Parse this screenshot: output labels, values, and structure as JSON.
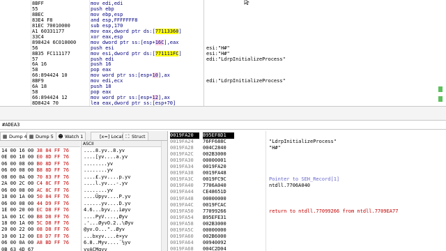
{
  "disasm": {
    "rows": [
      {
        "bytes": "8BFF",
        "instr": "mov edi,edi",
        "comment": ""
      },
      {
        "bytes": "55",
        "instr": "push ebp",
        "comment": ""
      },
      {
        "bytes": "8BEC",
        "instr": "mov ebp,esp",
        "comment": ""
      },
      {
        "bytes": "83E4 F8",
        "instr": "and esp,FFFFFFF8",
        "comment": ""
      },
      {
        "bytes": "81EC 70010000",
        "instr": "sub esp,170",
        "comment": ""
      },
      {
        "bytes": "A1 60331177",
        "instr": "mov eax,dword ptr ds:[77113360]",
        "comment": ""
      },
      {
        "bytes": "33C4",
        "instr": "xor eax,esp",
        "comment": ""
      },
      {
        "bytes": "898424 6C010000",
        "instr": "mov dword ptr ss:[esp+16C],eax",
        "comment": ""
      },
      {
        "bytes": "56",
        "instr": "push esi",
        "comment": "esi:\"H#\""
      },
      {
        "bytes": "8B35 FC111177",
        "instr": "mov esi,dword ptr ds:[771111FC]",
        "comment": "esi:\"H#\""
      },
      {
        "bytes": "57",
        "instr": "push edi",
        "comment": "edi:\"LdrpInitializeProcess\""
      },
      {
        "bytes": "6A 16",
        "instr": "push 16",
        "comment": ""
      },
      {
        "bytes": "58",
        "instr": "pop eax",
        "comment": ""
      },
      {
        "bytes": "66:894424 10",
        "instr": "mov word ptr ss:[esp+10],ax",
        "comment": ""
      },
      {
        "bytes": "8BF9",
        "instr": "mov edi,ecx",
        "comment": "edi:\"LdrpInitializeProcess\""
      },
      {
        "bytes": "6A 18",
        "instr": "push 18",
        "comment": ""
      },
      {
        "bytes": "58",
        "instr": "pop eax",
        "comment": ""
      },
      {
        "bytes": "66:894424 12",
        "instr": "mov word ptr ss:[esp+12],ax",
        "comment": ""
      },
      {
        "bytes": "8D8424 70",
        "instr": "lea eax,dword ptr ss:[esp+70]",
        "comment": ""
      }
    ]
  },
  "status": {
    "text": "#ADEA3"
  },
  "tabs": [
    {
      "label": "Dump 4",
      "icon": "dump-icon",
      "active": true
    },
    {
      "label": "Dump 5",
      "icon": "dump-icon",
      "active": false
    },
    {
      "label": "Watch 1",
      "icon": "watch-icon",
      "active": false
    },
    {
      "label": "[x=] Locals",
      "icon": "locals-icon",
      "active": false
    },
    {
      "label": "Struct",
      "icon": "struct-icon",
      "active": false
    }
  ],
  "dump": {
    "hex_header": "",
    "ascii_header": "ASCII",
    "rows": [
      {
        "hex_plain": "14 00 16 00 ",
        "hex_red": "38 84 FF 76",
        "ascii": "....8.yv..8.yv"
      },
      {
        "hex_plain": "0E 00 10 00 ",
        "hex_red": "E0 8D FF 76",
        "ascii": "....[yv....a.yv"
      },
      {
        "hex_plain": "06 00 08 00 ",
        "hex_red": "B0 8D FF 76",
        "ascii": "........yv"
      },
      {
        "hex_plain": "06 00 08 00 ",
        "hex_red": "B8 8D FF 76",
        "ascii": "........yv"
      },
      {
        "hex_plain": "08 00 0A 00 ",
        "hex_red": "70 83 FF 76",
        "ascii": "....£.yv....p.yv"
      },
      {
        "hex_plain": "2A 00 2C 00 ",
        "hex_red": "C4 8C FF 76",
        "ascii": "....l.yv...-.yv"
      },
      {
        "hex_plain": "06 00 08 00 ",
        "hex_red": "AC 8C FF 76",
        "ascii": "........yv"
      },
      {
        "hex_plain": "18 00 1A 00 ",
        "hex_red": "50 84 FF 76",
        "ascii": "....Üpyv....P.yv"
      },
      {
        "hex_plain": "06 00 08 00 ",
        "hex_red": "44 D9 FF 76",
        "ascii": "......yv....D.yv"
      },
      {
        "hex_plain": "1E 00 20 00 ",
        "hex_red": "EC D8 FF 76",
        "ascii": "4.6...byv...ìøyv"
      },
      {
        "hex_plain": "1A 00 1C 00 ",
        "hex_red": "B8 D8 FF 76",
        "ascii": "....PyV....,Øyv"
      },
      {
        "hex_plain": "18 00 1A 00 ",
        "hex_red": "5C D8 FF 76",
        "ascii": ".'...ØyvO.2..\\Øyv"
      },
      {
        "hex_plain": "20 00 22 00 ",
        "hex_red": "08 D8 FF 76",
        "ascii": "@yv.O...\"..Øyv"
      },
      {
        "hex_plain": "10 00 12 00 ",
        "hex_red": "E8 D7 FF 76",
        "ascii": "...bxyv....è×yv"
      },
      {
        "hex_plain": "06 00 0A 00 ",
        "hex_red": "A8 BD FF 76",
        "ascii": "6.8..Myv....¨½yv"
      },
      {
        "hex_plain": "0B 63 4D 67 ",
        "hex_red": "",
        "ascii": "yvACMgyv"
      }
    ]
  },
  "stack": {
    "rows": [
      {
        "addr": "0019FA20",
        "val": "B95EF8D1",
        "comment": "",
        "kind": "",
        "selected": true
      },
      {
        "addr": "0019FA24",
        "val": "76FF688C",
        "comment": "\"LdrpInitializeProcess\"",
        "kind": "",
        "selected": false
      },
      {
        "addr": "0019FA28",
        "val": "004C2840",
        "comment": "\"H#\"",
        "kind": "",
        "selected": false
      },
      {
        "addr": "0019FA2C",
        "val": "002B3000",
        "comment": "",
        "kind": "",
        "selected": false
      },
      {
        "addr": "0019FA30",
        "val": "00000001",
        "comment": "",
        "kind": "",
        "selected": false
      },
      {
        "addr": "0019FA34",
        "val": "0019FA20",
        "comment": "",
        "kind": "",
        "selected": false
      },
      {
        "addr": "0019FA38",
        "val": "0019FA48",
        "comment": "",
        "kind": "",
        "selected": false
      },
      {
        "addr": "0019FA3C",
        "val": "0019FC9C",
        "comment": "Pointer to SEH_Record[1]",
        "kind": "blue",
        "selected": false
      },
      {
        "addr": "0019FA40",
        "val": "7706A040",
        "comment": "ntdll.7706A040",
        "kind": "",
        "selected": false
      },
      {
        "addr": "0019FA44",
        "val": "CE48651D",
        "comment": "",
        "kind": "",
        "selected": false
      },
      {
        "addr": "0019FA48",
        "val": "00000000",
        "comment": "",
        "kind": "",
        "selected": false
      },
      {
        "addr": "0019FA4C",
        "val": "0019FCAC",
        "comment": "",
        "kind": "",
        "selected": false
      },
      {
        "addr": "0019FA50",
        "val": "77099266",
        "comment": "return to ntdll.77099266 from ntdll.7709EA77",
        "kind": "red",
        "selected": false
      },
      {
        "addr": "0019FA54",
        "val": "B95EFE31",
        "comment": "",
        "kind": "",
        "selected": false
      },
      {
        "addr": "0019FA58",
        "val": "002B3000",
        "comment": "",
        "kind": "",
        "selected": false
      },
      {
        "addr": "0019FA5C",
        "val": "00000000",
        "comment": "",
        "kind": "",
        "selected": false
      },
      {
        "addr": "0019FA60",
        "val": "002B6000",
        "comment": "",
        "kind": "",
        "selected": false
      },
      {
        "addr": "0019FA64",
        "val": "00940092",
        "comment": "",
        "kind": "",
        "selected": false
      },
      {
        "addr": "0019FA68",
        "val": "004C2D04",
        "comment": "",
        "kind": "",
        "selected": false
      }
    ]
  }
}
